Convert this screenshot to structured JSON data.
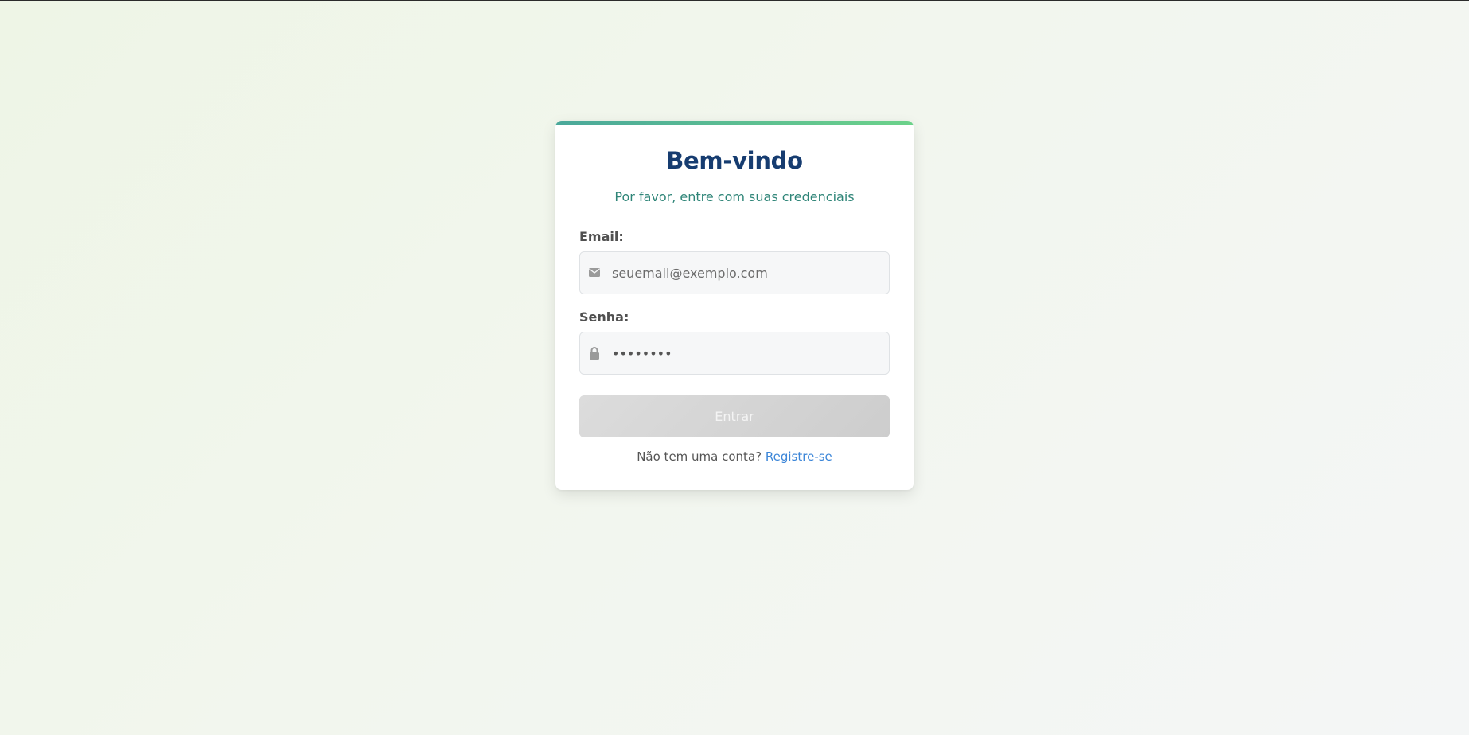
{
  "login": {
    "title": "Bem-vindo",
    "subtitle": "Por favor, entre com suas credenciais",
    "email": {
      "label": "Email:",
      "placeholder": "seuemail@exemplo.com",
      "value": "",
      "icon": "envelope-icon"
    },
    "password": {
      "label": "Senha:",
      "value": "••••••••",
      "icon": "lock-icon"
    },
    "submit_label": "Entrar",
    "footer_text": "Não tem uma conta?",
    "register_link": "Registre-se"
  },
  "colors": {
    "title": "#163c70",
    "subtitle": "#2f8578",
    "accent_start": "#4aa89a",
    "accent_end": "#6cd28a",
    "link": "#3c86d8",
    "button_disabled": "#d4d4d4"
  }
}
